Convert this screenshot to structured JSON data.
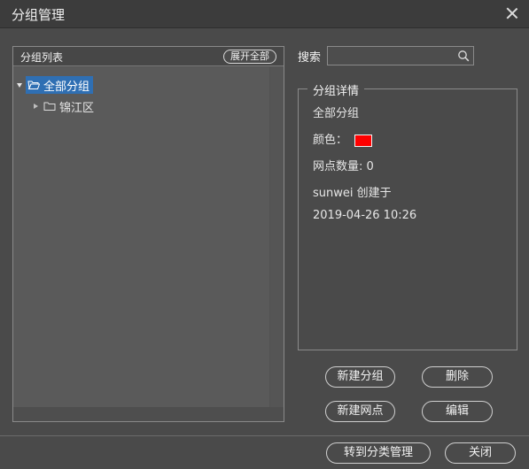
{
  "window": {
    "title": "分组管理",
    "close_icon": "close-icon"
  },
  "group_list": {
    "title": "分组列表",
    "expand_all_label": "展开全部",
    "tree": [
      {
        "label": "全部分组",
        "expanded": true,
        "selected": true,
        "icon": "folder-open-icon"
      },
      {
        "label": "锦江区",
        "expanded": false,
        "selected": false,
        "icon": "folder-icon"
      }
    ]
  },
  "search": {
    "label": "搜索",
    "value": "",
    "placeholder": "",
    "icon": "search-icon"
  },
  "details": {
    "legend": "分组详情",
    "group_name": "全部分组",
    "color_label": "颜色：",
    "color_value": "#ff0000",
    "count_line": "网点数量: 0",
    "creator_line": "sunwei 创建于",
    "created_at": "2019-04-26 10:26"
  },
  "actions": {
    "new_group": "新建分组",
    "delete": "删除",
    "new_site": "新建网点",
    "edit": "编辑"
  },
  "footer": {
    "category_manage": "转到分类管理",
    "close": "关闭"
  }
}
